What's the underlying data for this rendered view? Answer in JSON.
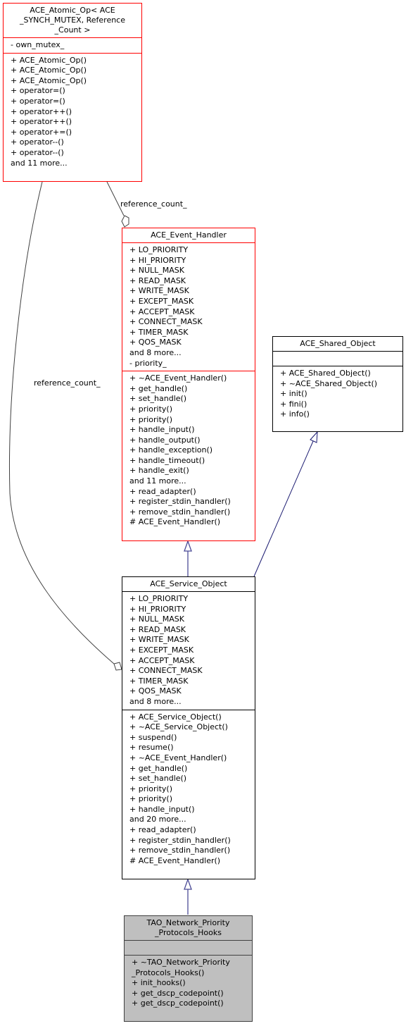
{
  "diagram": {
    "type": "UML class collaboration diagram",
    "classes": {
      "atomic_op": {
        "title": [
          "ACE_Atomic_Op< ACE",
          "_SYNCH_MUTEX, Reference",
          "_Count >"
        ],
        "attributes": [
          "- own_mutex_"
        ],
        "methods": [
          "+ ACE_Atomic_Op()",
          "+ ACE_Atomic_Op()",
          "+ ACE_Atomic_Op()",
          "+ operator=()",
          "+ operator=()",
          "+ operator++()",
          "+ operator++()",
          "+ operator+=()",
          "+ operator--()",
          "+ operator--()",
          "and 11 more..."
        ]
      },
      "event_handler": {
        "title": [
          "ACE_Event_Handler"
        ],
        "attributes": [
          "+ LO_PRIORITY",
          "+ HI_PRIORITY",
          "+ NULL_MASK",
          "+ READ_MASK",
          "+ WRITE_MASK",
          "+ EXCEPT_MASK",
          "+ ACCEPT_MASK",
          "+ CONNECT_MASK",
          "+ TIMER_MASK",
          "+ QOS_MASK",
          "and 8 more...",
          "- priority_"
        ],
        "methods": [
          "+ ~ACE_Event_Handler()",
          "+ get_handle()",
          "+ set_handle()",
          "+ priority()",
          "+ priority()",
          "+ handle_input()",
          "+ handle_output()",
          "+ handle_exception()",
          "+ handle_timeout()",
          "+ handle_exit()",
          "and 11 more...",
          "+ read_adapter()",
          "+ register_stdin_handler()",
          "+ remove_stdin_handler()",
          "# ACE_Event_Handler()"
        ]
      },
      "shared_object": {
        "title": [
          "ACE_Shared_Object"
        ],
        "attributes": [],
        "methods": [
          "+ ACE_Shared_Object()",
          "+ ~ACE_Shared_Object()",
          "+ init()",
          "+ fini()",
          "+ info()"
        ]
      },
      "service_object": {
        "title": [
          "ACE_Service_Object"
        ],
        "attributes": [
          "+ LO_PRIORITY",
          "+ HI_PRIORITY",
          "+ NULL_MASK",
          "+ READ_MASK",
          "+ WRITE_MASK",
          "+ EXCEPT_MASK",
          "+ ACCEPT_MASK",
          "+ CONNECT_MASK",
          "+ TIMER_MASK",
          "+ QOS_MASK",
          "and 8 more..."
        ],
        "methods": [
          "+ ACE_Service_Object()",
          "+ ~ACE_Service_Object()",
          "+ suspend()",
          "+ resume()",
          "+ ~ACE_Event_Handler()",
          "+ get_handle()",
          "+ set_handle()",
          "+ priority()",
          "+ priority()",
          "+ handle_input()",
          "and 20 more...",
          "+ read_adapter()",
          "+ register_stdin_handler()",
          "+ remove_stdin_handler()",
          "# ACE_Event_Handler()"
        ]
      },
      "tao_hooks": {
        "title": [
          "TAO_Network_Priority",
          "_Protocols_Hooks"
        ],
        "attributes": [],
        "methods": [
          "+ ~TAO_Network_Priority",
          "_Protocols_Hooks()",
          "+ init_hooks()",
          "+ get_dscp_codepoint()",
          "+ get_dscp_codepoint()"
        ]
      }
    },
    "edge_labels": {
      "ref_count_to_event_handler": "reference_count_",
      "ref_count_to_service_object": "reference_count_"
    },
    "colors": {
      "inherit_edge": "#191970",
      "inherit_edge_light": "#4b4b96",
      "usage_edge": "#404040",
      "red_border": "#ff0000",
      "selected_fill": "#bfbfbf"
    }
  }
}
